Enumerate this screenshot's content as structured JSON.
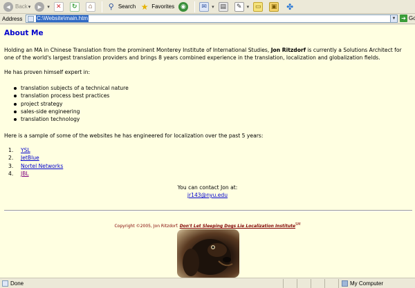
{
  "toolbar": {
    "back_label": "Back",
    "search_label": "Search",
    "favorites_label": "Favorites",
    "icons": [
      "back-icon",
      "forward-icon",
      "stop-icon",
      "refresh-icon",
      "home-icon",
      "search-icon",
      "favorites-icon",
      "media-icon",
      "mail-icon",
      "print-icon",
      "edit-icon",
      "discuss-icon",
      "folder-icon",
      "messenger-icon"
    ]
  },
  "address": {
    "label": "Address",
    "value": "C:\\Website\\main.htm",
    "go_label": "Go"
  },
  "page": {
    "title": "About Me",
    "intro_before": "Holding an MA in Chinese Translation from the prominent Monterey Institute of International Studies, ",
    "intro_name": "Jon Ritzdorf",
    "intro_after": " is currently a Solutions Architect for one of the world's largest translation providers and brings 8 years combined experience in the translation, localization and globalization fields.",
    "expert_intro": "He has proven himself expert in:",
    "expertise": [
      "translation subjects of a technical nature",
      "translation process best practices",
      "project strategy",
      "sales-side engineering",
      "translation technology"
    ],
    "sites_intro": "Here is a sample of some of the websites he has engineered for localization over the past 5 years:",
    "sites": [
      {
        "num": "1.",
        "label": "YSL"
      },
      {
        "num": "2.",
        "label": "JetBlue"
      },
      {
        "num": "3.",
        "label": "Nortel Networks"
      },
      {
        "num": "4.",
        "label": "JBL"
      }
    ],
    "contact_text": "You can contact Jon at:",
    "contact_email": "jr143@nyu.edu",
    "copyright_prefix": "Copyright ©2005, Jon Ritzdorf. ",
    "copyright_institute": "Don't Let Sleeping Dogs Lie Localization Institute",
    "copyright_tm": "SM"
  },
  "status": {
    "text": "Done",
    "zone": "My Computer"
  },
  "colors": {
    "page_bg": "#ffffe1",
    "title": "#0000cc",
    "link": "#0000cc",
    "visited_link": "#800080",
    "copyright": "#800000"
  }
}
